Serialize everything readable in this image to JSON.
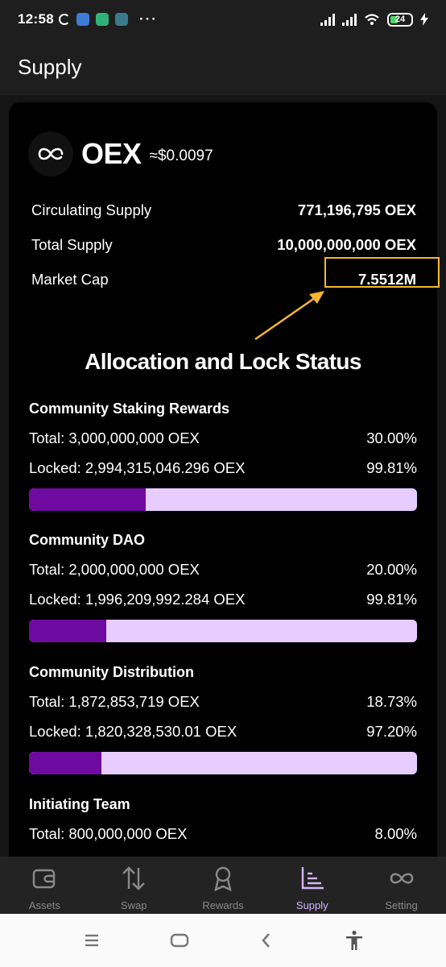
{
  "status_bar": {
    "time": "12:58",
    "battery": "24"
  },
  "header": {
    "title": "Supply"
  },
  "token": {
    "symbol": "OEX",
    "price": "≈$0.0097"
  },
  "supply": [
    {
      "label": "Circulating Supply",
      "value": "771,196,795 OEX"
    },
    {
      "label": "Total Supply",
      "value": "10,000,000,000 OEX"
    },
    {
      "label": "Market Cap",
      "value": "7.5512M"
    }
  ],
  "allocation": {
    "heading": "Allocation and Lock Status",
    "items": [
      {
        "title": "Community Staking Rewards",
        "total": "Total: 3,000,000,000 OEX",
        "total_pct": "30.00%",
        "locked": "Locked: 2,994,315,046.296 OEX",
        "locked_pct": "99.81%",
        "bar_fraction": 0.3
      },
      {
        "title": "Community DAO",
        "total": "Total: 2,000,000,000 OEX",
        "total_pct": "20.00%",
        "locked": "Locked: 1,996,209,992.284 OEX",
        "locked_pct": "99.81%",
        "bar_fraction": 0.2
      },
      {
        "title": "Community Distribution",
        "total": "Total: 1,872,853,719 OEX",
        "total_pct": "18.73%",
        "locked": "Locked: 1,820,328,530.01 OEX",
        "locked_pct": "97.20%",
        "bar_fraction": 0.1873
      },
      {
        "title": "Initiating Team",
        "total": "Total: 800,000,000 OEX",
        "total_pct": "8.00%"
      }
    ]
  },
  "tabs": [
    {
      "label": "Assets",
      "icon": "wallet-icon"
    },
    {
      "label": "Swap",
      "icon": "swap-arrows-icon"
    },
    {
      "label": "Rewards",
      "icon": "medal-icon"
    },
    {
      "label": "Supply",
      "icon": "bar-chart-icon",
      "active": true
    },
    {
      "label": "Setting",
      "icon": "infinity-icon"
    }
  ],
  "colors": {
    "accent": "#d6b4ff",
    "bar_fill": "#6e0aa0",
    "bar_track": "#e6ccff",
    "highlight": "#f5b731"
  }
}
